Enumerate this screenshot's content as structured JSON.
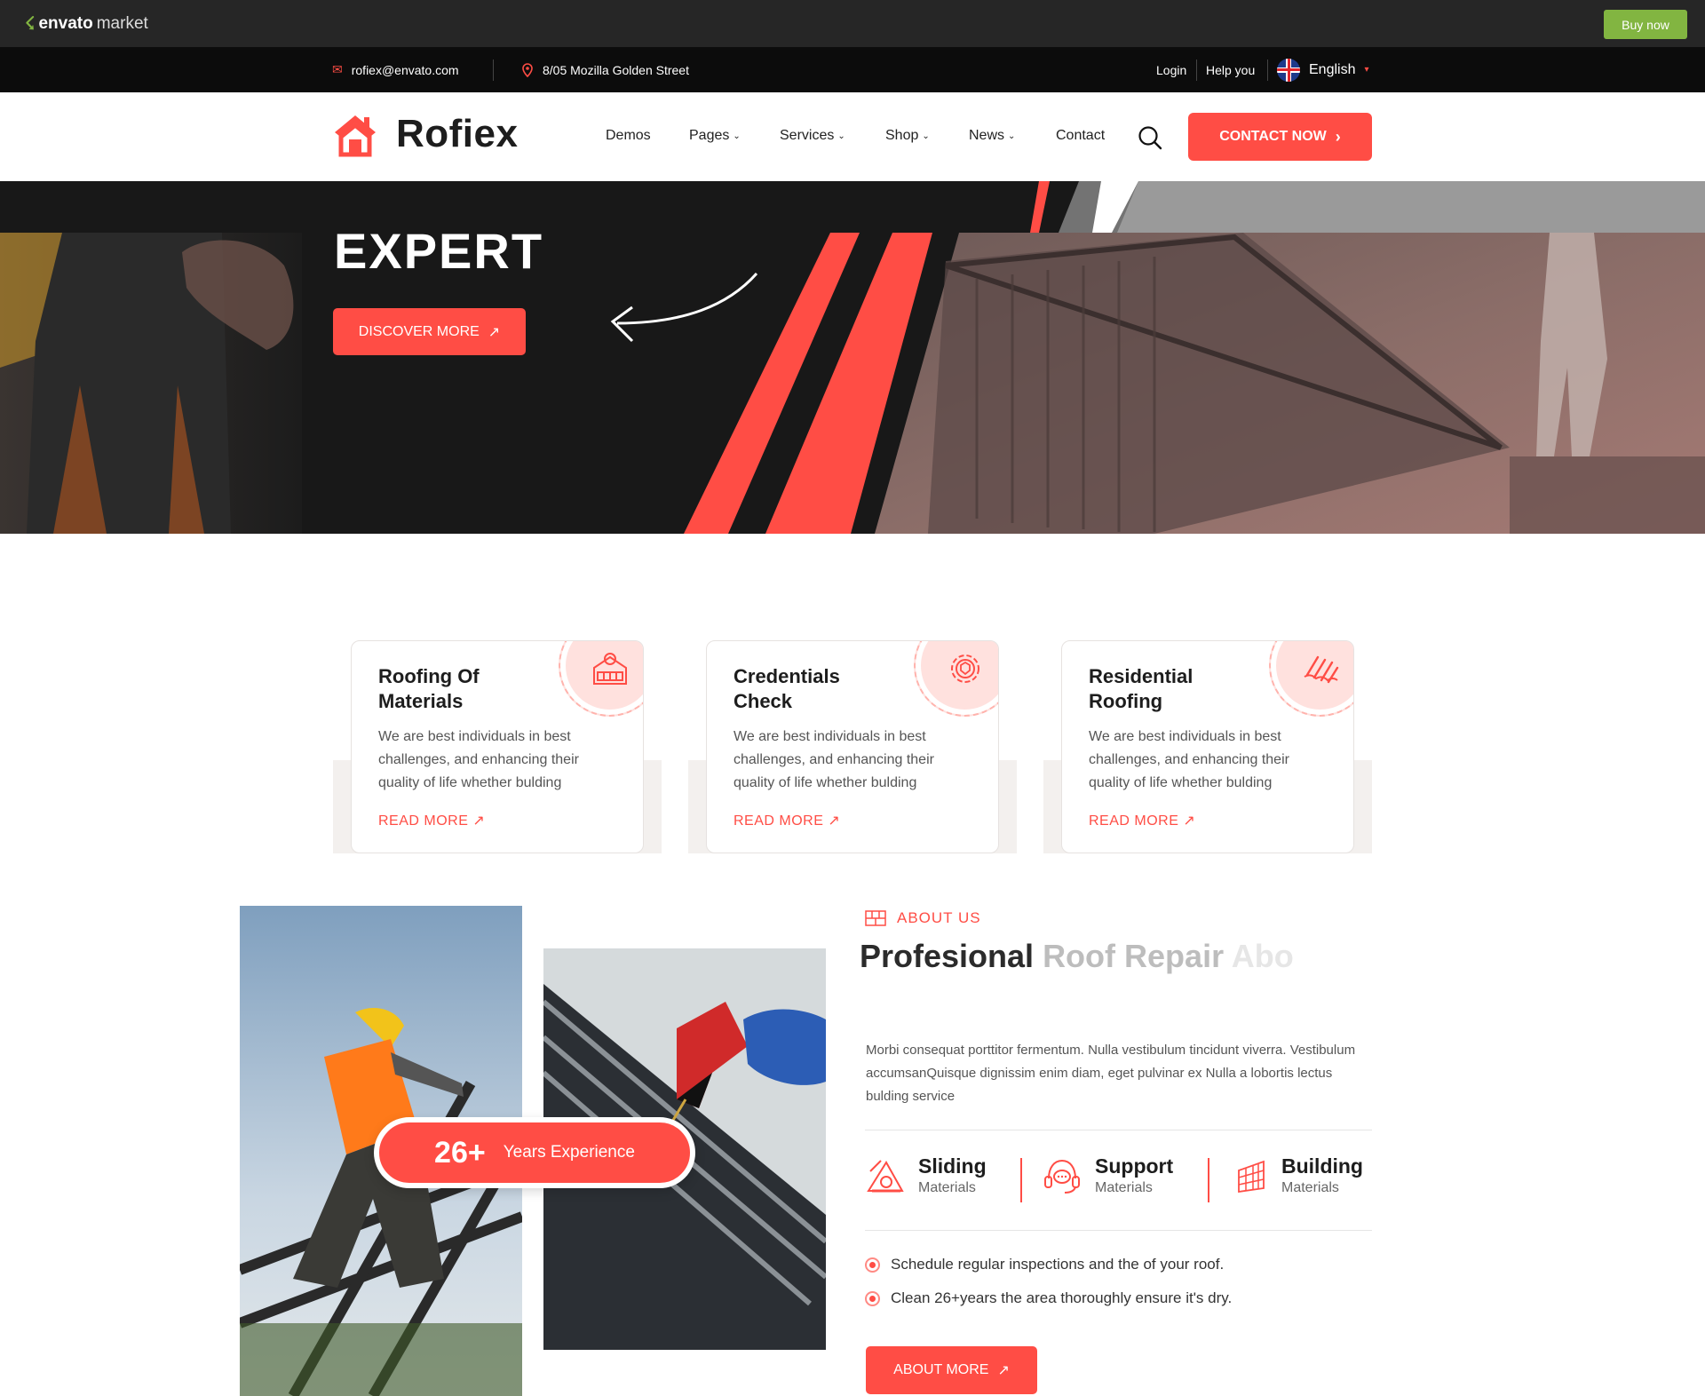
{
  "envato": {
    "brand": "envato",
    "brand_suffix": "market",
    "buy_now": "Buy now"
  },
  "topbar": {
    "email": "rofiex@envato.com",
    "address": "8/05 Mozilla Golden Street",
    "login": "Login",
    "help": "Help you",
    "language": "English"
  },
  "header": {
    "logo": "Rofiex",
    "nav": [
      {
        "label": "Demos",
        "has_dropdown": false
      },
      {
        "label": "Pages",
        "has_dropdown": true
      },
      {
        "label": "Services",
        "has_dropdown": true
      },
      {
        "label": "Shop",
        "has_dropdown": true
      },
      {
        "label": "News",
        "has_dropdown": true
      },
      {
        "label": "Contact",
        "has_dropdown": false
      }
    ],
    "cta": "CONTACT NOW"
  },
  "hero": {
    "title": "EXPERT",
    "button": "DISCOVER MORE"
  },
  "services": [
    {
      "title": "Roofing Of Materials",
      "icon": "house-shop-icon",
      "text": "We are best individuals in best challenges, and enhancing their quality of life whether bulding",
      "link": "READ MORE"
    },
    {
      "title": "Credentials Check",
      "icon": "gear-shield-icon",
      "text": "We are best individuals in best challenges, and enhancing their quality of life whether bulding",
      "link": "READ MORE"
    },
    {
      "title": "Residential Roofing",
      "icon": "roof-tiles-icon",
      "text": "We are best individuals in best challenges, and enhancing their quality of life whether bulding",
      "link": "READ MORE"
    }
  ],
  "about": {
    "tag": "ABOUT US",
    "title_part1": "Profesional ",
    "title_part2": "Roof Repair ",
    "title_part3": "Abo",
    "text": "Morbi consequat porttitor fermentum. Nulla vestibulum tincidunt viverra. Vestibulum accumsanQuisque dignissim enim diam, eget pulvinar ex Nulla a lobortis lectus bulding service",
    "experience_num": "26+",
    "experience_label": "Years Experience",
    "features": [
      {
        "title": "Sliding",
        "sub": "Materials",
        "icon": "ladder-roof-icon"
      },
      {
        "title": "Support",
        "sub": "Materials",
        "icon": "headset-chat-icon"
      },
      {
        "title": "Building",
        "sub": "Materials",
        "icon": "brick-wall-icon"
      }
    ],
    "checks": [
      "Schedule regular inspections and the of your roof.",
      "Clean 26+years the area thoroughly ensure it's dry."
    ],
    "button": "ABOUT MORE"
  },
  "colors": {
    "accent": "#ff4d45",
    "dark": "#161616",
    "envato_green": "#82b541"
  }
}
